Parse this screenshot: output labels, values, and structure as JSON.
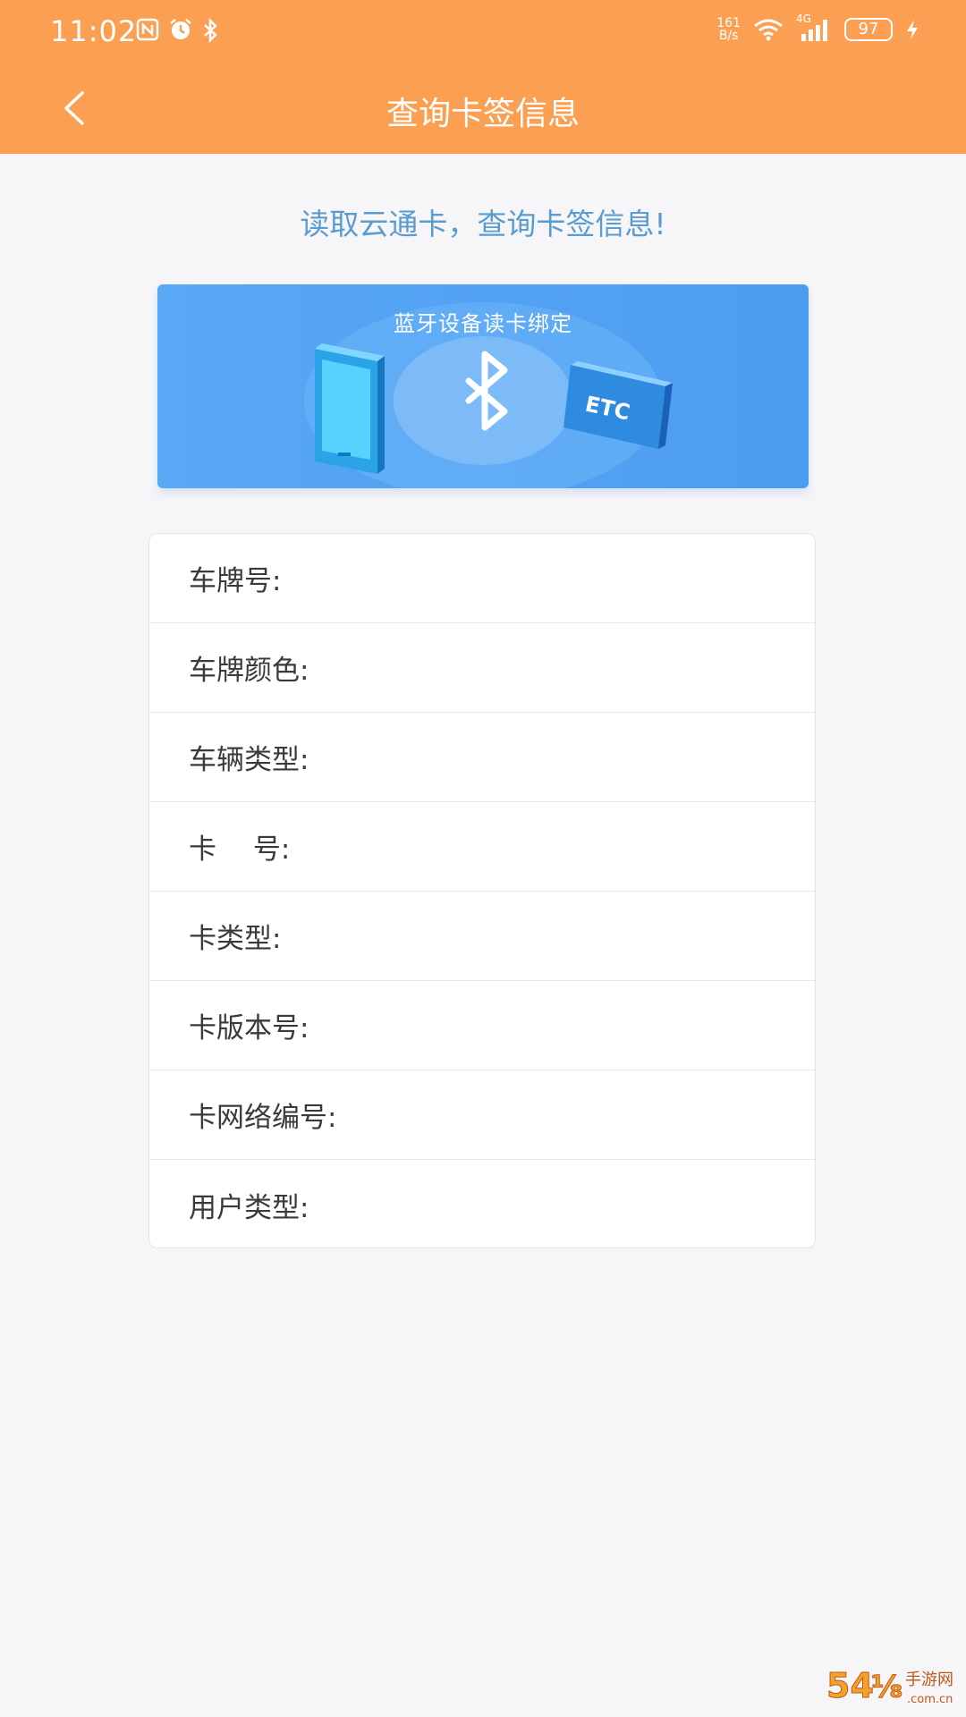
{
  "status_bar": {
    "time": "11:02",
    "net_speed_value": "161",
    "net_speed_unit": "B/s",
    "network_type": "4G",
    "battery_level": "97"
  },
  "header": {
    "title": "查询卡签信息",
    "back_icon": "chevron-left-icon"
  },
  "subtitle": "读取云通卡，查询卡签信息!",
  "banner": {
    "title": "蓝牙设备读卡绑定",
    "etc_label": "ETC"
  },
  "info_rows": [
    {
      "label": "车牌号:",
      "value": ""
    },
    {
      "label": "车牌颜色:",
      "value": ""
    },
    {
      "label": "车辆类型:",
      "value": ""
    },
    {
      "label": "卡　 号:",
      "value": ""
    },
    {
      "label": "卡类型:",
      "value": ""
    },
    {
      "label": "卡版本号:",
      "value": ""
    },
    {
      "label": "卡网络编号:",
      "value": ""
    },
    {
      "label": "用户类型:",
      "value": ""
    }
  ],
  "watermark": {
    "text": "54⅛ 手游网 .com.cn"
  },
  "colors": {
    "header_bg": "#fba052",
    "banner_bg": "#4c9cf2",
    "subtitle_text": "#5a9bd0",
    "page_bg": "#f6f6f8"
  }
}
